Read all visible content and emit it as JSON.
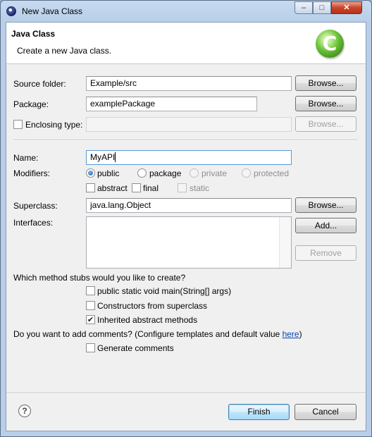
{
  "window": {
    "title": "New Java Class",
    "minimize_glyph": "–",
    "maximize_glyph": "□",
    "close_glyph": "✕"
  },
  "header": {
    "title": "Java Class",
    "description": "Create a new Java class.",
    "logo_glyph": "C",
    "logo_icon": "java-class-wizard-icon"
  },
  "form": {
    "source_folder": {
      "label": "Source folder:",
      "value": "Example/src",
      "browse": "Browse..."
    },
    "package": {
      "label": "Package:",
      "value": "examplePackage",
      "browse": "Browse..."
    },
    "enclosing_type": {
      "label": "Enclosing type:",
      "value": "",
      "browse": "Browse...",
      "checked": false
    },
    "name": {
      "label": "Name:",
      "value": "MyAPI"
    },
    "modifiers": {
      "label": "Modifiers:",
      "access": [
        {
          "label": "public",
          "checked": true,
          "enabled": true
        },
        {
          "label": "package",
          "checked": false,
          "enabled": true
        },
        {
          "label": "private",
          "checked": false,
          "enabled": false
        },
        {
          "label": "protected",
          "checked": false,
          "enabled": false
        }
      ],
      "flags": [
        {
          "label": "abstract",
          "checked": false,
          "enabled": true
        },
        {
          "label": "final",
          "checked": false,
          "enabled": true
        },
        {
          "label": "static",
          "checked": false,
          "enabled": false
        }
      ]
    },
    "superclass": {
      "label": "Superclass:",
      "value": "java.lang.Object",
      "browse": "Browse..."
    },
    "interfaces": {
      "label": "Interfaces:",
      "add": "Add...",
      "remove": "Remove"
    },
    "stubs": {
      "question": "Which method stubs would you like to create?",
      "options": [
        {
          "label": "public static void main(String[] args)",
          "checked": false
        },
        {
          "label": "Constructors from superclass",
          "checked": false
        },
        {
          "label": "Inherited abstract methods",
          "checked": true
        }
      ]
    },
    "comments": {
      "question_prefix": "Do you want to add comments? (Configure templates and default value ",
      "link": "here",
      "question_suffix": ")",
      "option": {
        "label": "Generate comments",
        "checked": false
      }
    }
  },
  "footer": {
    "help_glyph": "?",
    "finish": "Finish",
    "cancel": "Cancel"
  },
  "checkmark_glyph": "✔"
}
